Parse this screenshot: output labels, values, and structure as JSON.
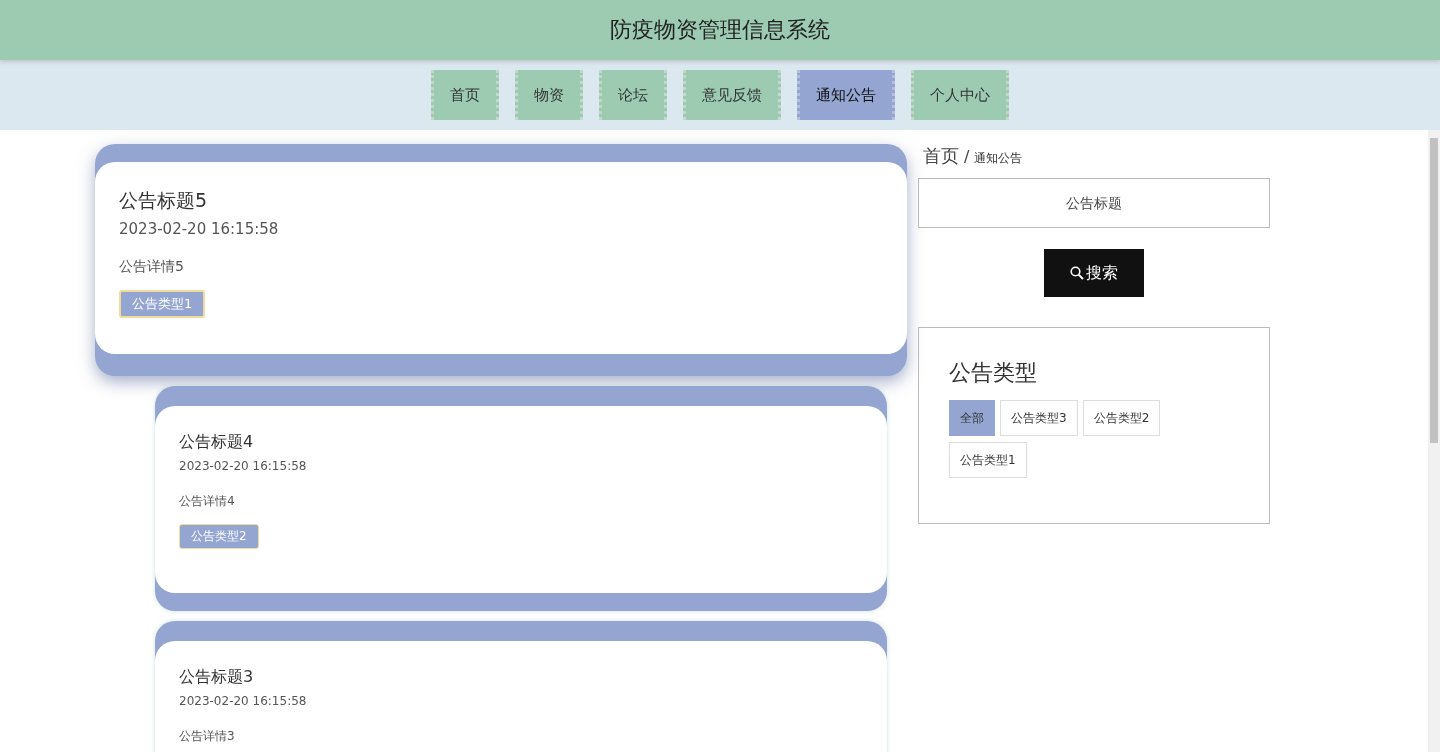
{
  "header": {
    "title": "防疫物资管理信息系统"
  },
  "nav": [
    {
      "label": "首页",
      "selected": false
    },
    {
      "label": "物资",
      "selected": false
    },
    {
      "label": "论坛",
      "selected": false
    },
    {
      "label": "意见反馈",
      "selected": false
    },
    {
      "label": "通知公告",
      "selected": true
    },
    {
      "label": "个人中心",
      "selected": false
    }
  ],
  "notices": [
    {
      "title": "公告标题5",
      "time": "2023-02-20 16:15:58",
      "detail": "公告详情5",
      "tag": "公告类型1",
      "hovered": true
    },
    {
      "title": "公告标题4",
      "time": "2023-02-20 16:15:58",
      "detail": "公告详情4",
      "tag": "公告类型2",
      "hovered": false
    },
    {
      "title": "公告标题3",
      "time": "2023-02-20 16:15:58",
      "detail": "公告详情3",
      "hovered": false
    }
  ],
  "breadcrumb": {
    "home": "首页",
    "separator": "/",
    "current": "通知公告"
  },
  "search": {
    "placeholder": "公告标题",
    "button": "搜索"
  },
  "types": {
    "title": "公告类型",
    "items": [
      {
        "label": "全部",
        "selected": true
      },
      {
        "label": "公告类型3",
        "selected": false
      },
      {
        "label": "公告类型2",
        "selected": false
      },
      {
        "label": "公告类型1",
        "selected": false
      }
    ]
  }
}
